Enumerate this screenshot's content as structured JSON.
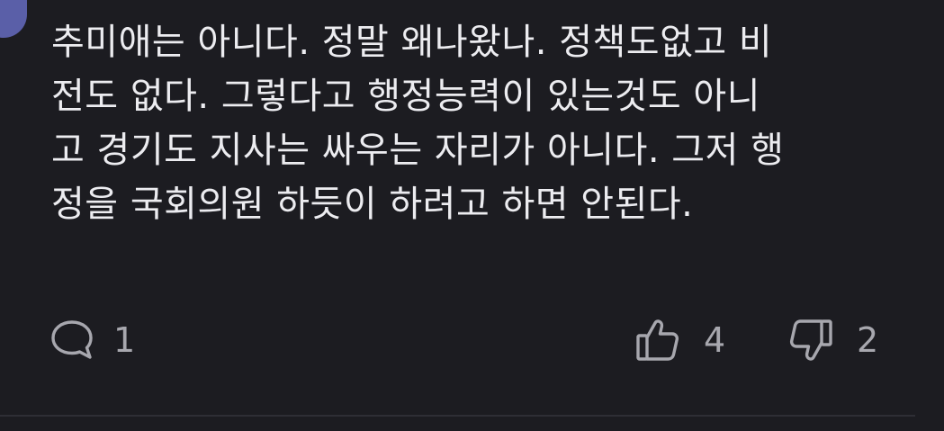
{
  "comment": {
    "lines": [
      "추미애는 아니다. 정말 왜나왔나. 정책도없고 비",
      "전도 없다. 그렇다고 행정능력이 있는것도 아니",
      "고 경기도 지사는 싸우는 자리가 아니다. 그저 행",
      "정을 국회의원 하듯이 하려고 하면 안된다."
    ]
  },
  "actions": {
    "reply_count": "1",
    "like_count": "4",
    "dislike_count": "2"
  },
  "icons": {
    "reply": "speech-bubble-icon",
    "like": "thumbs-up-icon",
    "dislike": "thumbs-down-icon"
  },
  "colors": {
    "background": "#1c1c21",
    "text": "#ececf0",
    "muted": "#a7a7ae",
    "avatar": "#5a5fa8"
  }
}
